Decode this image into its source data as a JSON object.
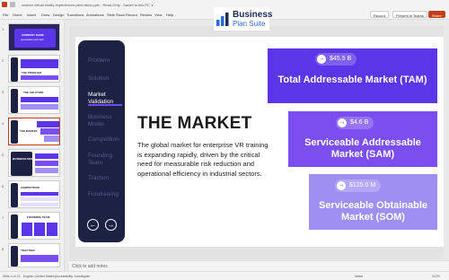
{
  "window": {
    "file_title": "custom virtual reality experiences pitch deck.pptx  -  Read-Only  -  Saved to this PC  ∨"
  },
  "menu": {
    "items": [
      "File",
      "Home",
      "Insert",
      "Draw",
      "Design",
      "Transitions",
      "Animations",
      "Slide Show",
      "Record",
      "Review",
      "View",
      "Help"
    ],
    "record_label": "Record",
    "present_label": "Present in Teams",
    "share_label": "Share"
  },
  "brand": {
    "line1": "Business",
    "line2": "Plan Suite"
  },
  "thumbnails": [
    {
      "num": "1",
      "title": "COMPANY NAME",
      "sub": "presentation pitch deck"
    },
    {
      "num": "2",
      "title": "THE PROBLEM",
      "sub": ""
    },
    {
      "num": "3",
      "title": "THE SOLUTION",
      "sub": ""
    },
    {
      "num": "4",
      "title": "THE MARKET",
      "sub": ""
    },
    {
      "num": "5",
      "title": "BUSINESS MODEL",
      "sub": ""
    },
    {
      "num": "6",
      "title": "COMPETITION",
      "sub": ""
    },
    {
      "num": "7",
      "title": "FOUNDING TEAM",
      "sub": ""
    },
    {
      "num": "8",
      "title": "TRACTION",
      "sub": ""
    }
  ],
  "slide": {
    "nav": [
      "Problem",
      "Solution",
      "Market Validation",
      "Business Model",
      "Competition",
      "Founding Team",
      "Traction",
      "Fundraising"
    ],
    "active_nav": "Market Validation",
    "prev_icon": "←",
    "next_icon": "→",
    "title": "THE MARKET",
    "body": "The global market for enterprise VR training is expanding rapidly, driven by the critical need for measurable risk reduction and operational efficiency in industrial sectors.",
    "cards": [
      {
        "value": "$45.5 B",
        "label": "Total Addressable Market (TAM)"
      },
      {
        "value": "$4.6 B",
        "label": "Serviceable Addressable Market (SAM)"
      },
      {
        "value": "$125.0 M",
        "label": "Serviceable Obtainable Market (SOM)"
      }
    ]
  },
  "notes": {
    "placeholder": "Click to add notes"
  },
  "status": {
    "slide_info": "Slide 4 of 13",
    "language": "English (United States)",
    "accessibility": "Accessibility: Investigate",
    "notes_btn": "Notes",
    "zoom": "112%"
  }
}
